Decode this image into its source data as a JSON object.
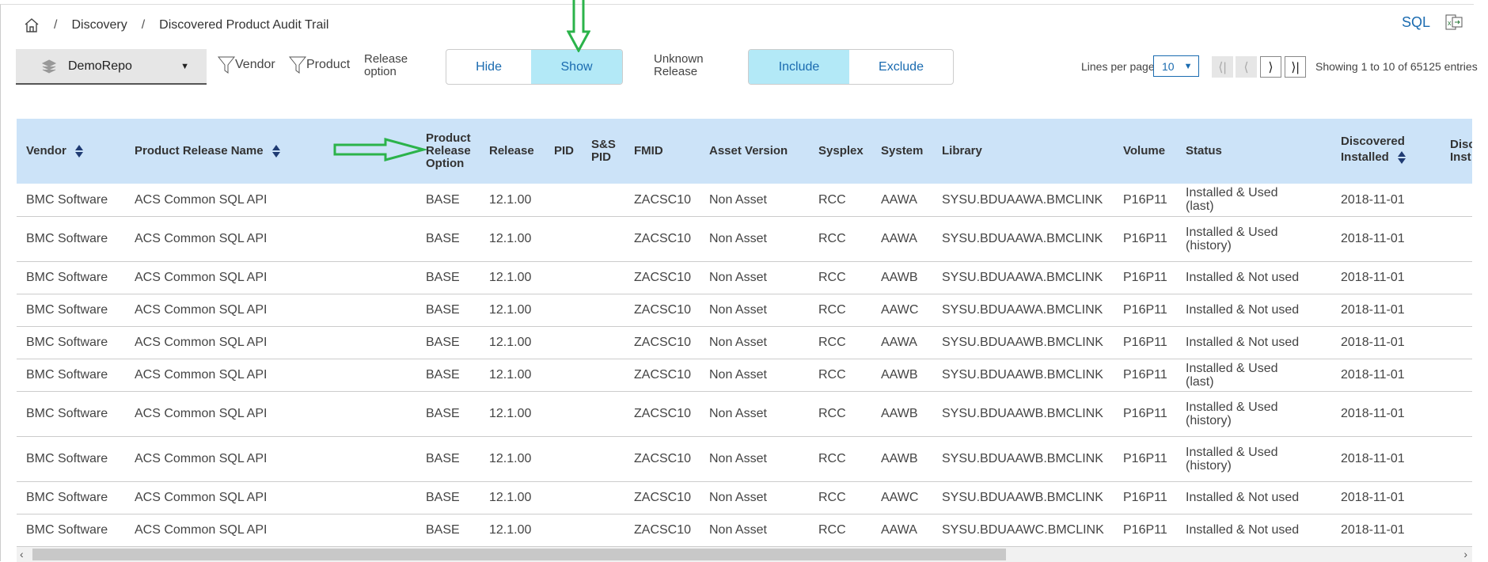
{
  "breadcrumb": {
    "items": [
      "Discovery",
      "Discovered Product Audit Trail"
    ]
  },
  "header_actions": {
    "sql": "SQL"
  },
  "toolbar": {
    "repo": "DemoRepo",
    "vendor_filter": "Vendor",
    "product_filter": "Product",
    "release_option_label": [
      "Release",
      "option"
    ],
    "hide": "Hide",
    "show": "Show",
    "show_selected": true,
    "unknown_release_label": [
      "Unknown",
      "Release"
    ],
    "include": "Include",
    "exclude": "Exclude",
    "include_selected": true
  },
  "pagination": {
    "lines_per_page_label": "Lines per page",
    "lines_per_page": "10",
    "first": "⟨|",
    "prev": "⟨",
    "next": "⟩",
    "last": "⟩|",
    "showing": "Showing 1 to 10 of 65125 entries"
  },
  "table": {
    "columns": [
      "Vendor",
      "Product Release Name",
      "Product Release Option",
      "Release",
      "PID",
      "S&S PID",
      "FMID",
      "Asset Version",
      "Sysplex",
      "System",
      "Library",
      "Volume",
      "Status",
      "Discovered Installed",
      "Disc Inst"
    ],
    "rows": [
      [
        "BMC Software",
        "ACS Common SQL API",
        "BASE",
        "12.1.00",
        "",
        "",
        "ZACSC10",
        "Non Asset",
        "RCC",
        "AAWA",
        "SYSU.BDUAAWA.BMCLINK",
        "P16P11",
        "Installed & Used (last)",
        "2018-11-01",
        ""
      ],
      [
        "BMC Software",
        "ACS Common SQL API",
        "BASE",
        "12.1.00",
        "",
        "",
        "ZACSC10",
        "Non Asset",
        "RCC",
        "AAWA",
        "SYSU.BDUAAWA.BMCLINK",
        "P16P11",
        "Installed & Used (history)",
        "2018-11-01",
        ""
      ],
      [
        "BMC Software",
        "ACS Common SQL API",
        "BASE",
        "12.1.00",
        "",
        "",
        "ZACSC10",
        "Non Asset",
        "RCC",
        "AAWB",
        "SYSU.BDUAAWA.BMCLINK",
        "P16P11",
        "Installed & Not used",
        "2018-11-01",
        ""
      ],
      [
        "BMC Software",
        "ACS Common SQL API",
        "BASE",
        "12.1.00",
        "",
        "",
        "ZACSC10",
        "Non Asset",
        "RCC",
        "AAWC",
        "SYSU.BDUAAWA.BMCLINK",
        "P16P11",
        "Installed & Not used",
        "2018-11-01",
        ""
      ],
      [
        "BMC Software",
        "ACS Common SQL API",
        "BASE",
        "12.1.00",
        "",
        "",
        "ZACSC10",
        "Non Asset",
        "RCC",
        "AAWA",
        "SYSU.BDUAAWB.BMCLINK",
        "P16P11",
        "Installed & Not used",
        "2018-11-01",
        ""
      ],
      [
        "BMC Software",
        "ACS Common SQL API",
        "BASE",
        "12.1.00",
        "",
        "",
        "ZACSC10",
        "Non Asset",
        "RCC",
        "AAWB",
        "SYSU.BDUAAWB.BMCLINK",
        "P16P11",
        "Installed & Used (last)",
        "2018-11-01",
        ""
      ],
      [
        "BMC Software",
        "ACS Common SQL API",
        "BASE",
        "12.1.00",
        "",
        "",
        "ZACSC10",
        "Non Asset",
        "RCC",
        "AAWB",
        "SYSU.BDUAAWB.BMCLINK",
        "P16P11",
        "Installed & Used (history)",
        "2018-11-01",
        ""
      ],
      [
        "BMC Software",
        "ACS Common SQL API",
        "BASE",
        "12.1.00",
        "",
        "",
        "ZACSC10",
        "Non Asset",
        "RCC",
        "AAWB",
        "SYSU.BDUAAWB.BMCLINK",
        "P16P11",
        "Installed & Used (history)",
        "2018-11-01",
        ""
      ],
      [
        "BMC Software",
        "ACS Common SQL API",
        "BASE",
        "12.1.00",
        "",
        "",
        "ZACSC10",
        "Non Asset",
        "RCC",
        "AAWC",
        "SYSU.BDUAAWB.BMCLINK",
        "P16P11",
        "Installed & Not used",
        "2018-11-01",
        ""
      ],
      [
        "BMC Software",
        "ACS Common SQL API",
        "BASE",
        "12.1.00",
        "",
        "",
        "ZACSC10",
        "Non Asset",
        "RCC",
        "AAWA",
        "SYSU.BDUAAWC.BMCLINK",
        "P16P11",
        "Installed & Not used",
        "2018-11-01",
        ""
      ]
    ]
  },
  "colors": {
    "accent": "#1a6bb0",
    "selected": "#b3e9f7",
    "header_bg": "#cce3f8",
    "annotation": "#2bb34a"
  }
}
